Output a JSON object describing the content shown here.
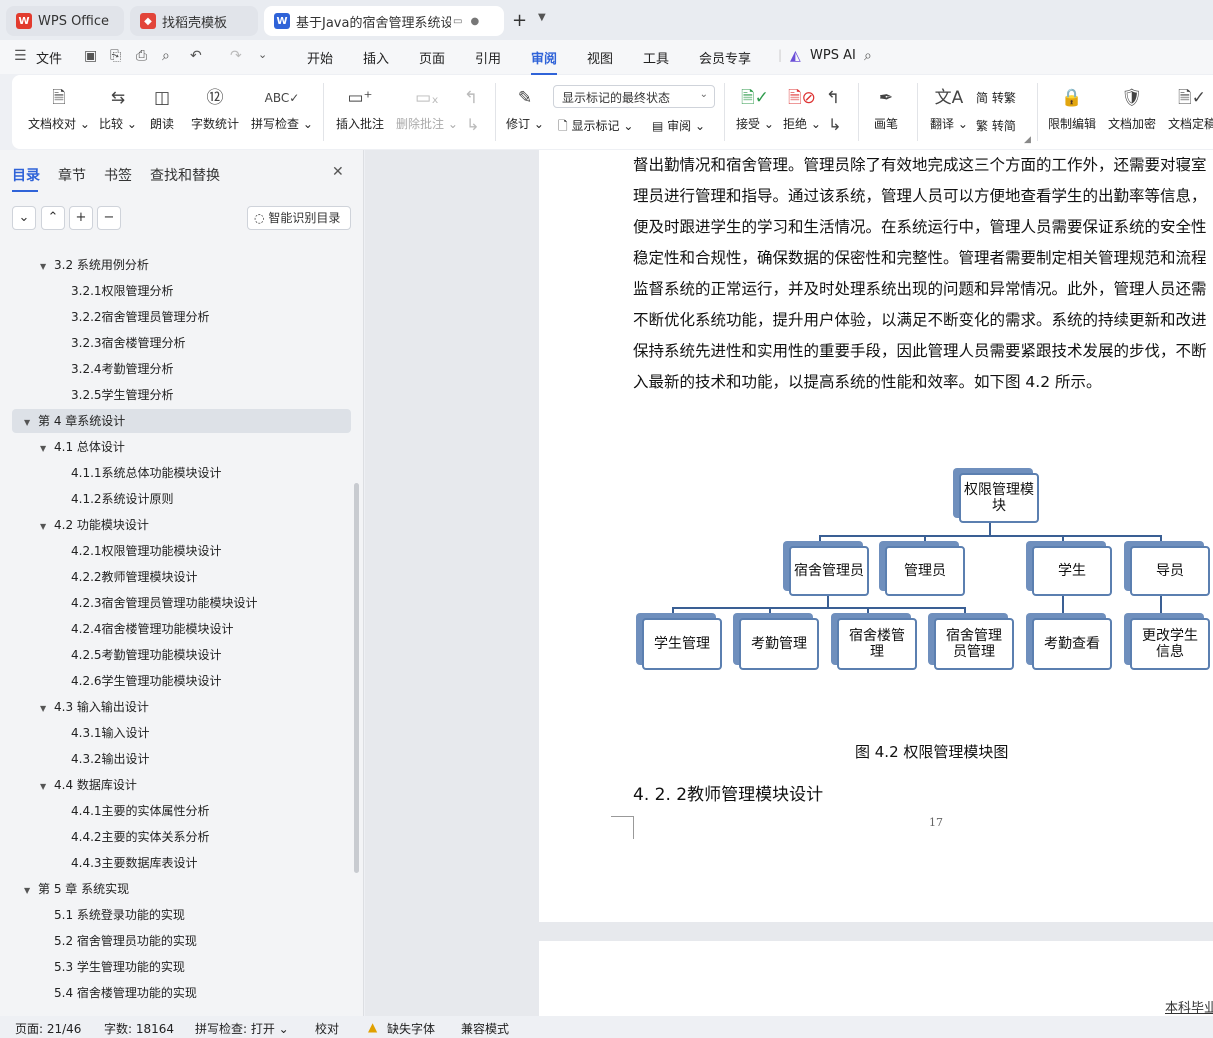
{
  "tabs": {
    "wps": "WPS Office",
    "template": "找稻壳模板",
    "doc": "基于Java的宿舍管理系统设计与实现",
    "new": "+",
    "more": "⌄"
  },
  "menu": {
    "file": "文件",
    "items": [
      "开始",
      "插入",
      "页面",
      "引用",
      "审阅",
      "视图",
      "工具",
      "会员专享"
    ],
    "wps_ai": "WPS AI"
  },
  "ribbon": {
    "proof": "文档校对",
    "compare": "比较",
    "read": "朗读",
    "wordcount": "字数统计",
    "spell": "拼写检查",
    "insert_comment": "插入批注",
    "delete_comment": "删除批注",
    "track": "修订",
    "show_markup_select": "显示标记的最终状态",
    "show_markup": "显示标记",
    "review": "审阅",
    "accept": "接受",
    "reject": "拒绝",
    "pen": "画笔",
    "translate": "翻译",
    "to_trad": "简 转繁",
    "to_simp": "繁 转简",
    "restrict": "限制编辑",
    "encrypt": "文档加密",
    "finalize": "文档定稿"
  },
  "sidebar": {
    "tabs": [
      "目录",
      "章节",
      "书签",
      "查找和替换"
    ],
    "smart_toc": "智能识别目录",
    "toc": [
      {
        "text": "3.2 系统用例分析",
        "level": 2,
        "arrow": true
      },
      {
        "text": "3.2.1权限管理分析",
        "level": 3
      },
      {
        "text": "3.2.2宿舍管理员管理分析",
        "level": 3
      },
      {
        "text": "3.2.3宿舍楼管理分析",
        "level": 3
      },
      {
        "text": "3.2.4考勤管理分析",
        "level": 3
      },
      {
        "text": "3.2.5学生管理分析",
        "level": 3
      },
      {
        "text": "第 4 章系统设计",
        "level": 1,
        "arrow": true,
        "selected": true
      },
      {
        "text": "4.1 总体设计",
        "level": 2,
        "arrow": true
      },
      {
        "text": "4.1.1系统总体功能模块设计",
        "level": 3
      },
      {
        "text": "4.1.2系统设计原则",
        "level": 3
      },
      {
        "text": "4.2 功能模块设计",
        "level": 2,
        "arrow": true
      },
      {
        "text": "4.2.1权限管理功能模块设计",
        "level": 3
      },
      {
        "text": "4.2.2教师管理模块设计",
        "level": 3
      },
      {
        "text": "4.2.3宿舍管理员管理功能模块设计",
        "level": 3
      },
      {
        "text": "4.2.4宿舍楼管理功能模块设计",
        "level": 3
      },
      {
        "text": "4.2.5考勤管理功能模块设计",
        "level": 3
      },
      {
        "text": "4.2.6学生管理功能模块设计",
        "level": 3
      },
      {
        "text": "4.3 输入输出设计",
        "level": 2,
        "arrow": true
      },
      {
        "text": "4.3.1输入设计",
        "level": 3
      },
      {
        "text": "4.3.2输出设计",
        "level": 3
      },
      {
        "text": "4.4 数据库设计",
        "level": 2,
        "arrow": true
      },
      {
        "text": "4.4.1主要的实体属性分析",
        "level": 3
      },
      {
        "text": "4.4.2主要的实体关系分析",
        "level": 3
      },
      {
        "text": "4.4.3主要数据库表设计",
        "level": 3
      },
      {
        "text": "第 5 章 系统实现",
        "level": 1,
        "arrow": true
      },
      {
        "text": "5.1 系统登录功能的实现",
        "level": 2
      },
      {
        "text": "5.2 宿舍管理员功能的实现",
        "level": 2
      },
      {
        "text": "5.3 学生管理功能的实现",
        "level": 2
      },
      {
        "text": "5.4 宿舍楼管理功能的实现",
        "level": 2
      }
    ]
  },
  "doc": {
    "paragraph": [
      "督出勤情况和宿舍管理。管理员除了有效地完成这三个方面的工作外，还需要对寝室",
      "理员进行管理和指导。通过该系统，管理人员可以方便地查看学生的出勤率等信息，",
      "便及时跟进学生的学习和生活情况。在系统运行中，管理人员需要保证系统的安全性",
      "稳定性和合规性，确保数据的保密性和完整性。管理者需要制定相关管理规范和流程",
      "监督系统的正常运行，并及时处理系统出现的问题和异常情况。此外，管理人员还需",
      "不断优化系统功能，提升用户体验，以满足不断变化的需求。系统的持续更新和改进",
      "保持系统先进性和实用性的重要手段，因此管理人员需要紧跟技术发展的步伐，不断",
      "入最新的技术和功能，以提高系统的性能和效率。如下图 4.2 所示。"
    ],
    "diagram": {
      "root": "权限管理模块",
      "level1": [
        "宿舍管理员",
        "管理员",
        "学生",
        "导员"
      ],
      "level2": [
        "学生管理",
        "考勤管理",
        "宿舍楼管理",
        "宿舍管理员管理",
        "考勤查看",
        "更改学生信息"
      ]
    },
    "caption": "图 4.2 权限管理模块图",
    "heading": "4. 2. 2教师管理模块设计",
    "page_number": "17",
    "next_page_header": "本科毕业"
  },
  "status": {
    "page": "页面: 21/46",
    "words": "字数: 18164",
    "spell": "拼写检查: 打开",
    "proof": "校对",
    "missing_font": "缺失字体",
    "compat": "兼容模式"
  }
}
